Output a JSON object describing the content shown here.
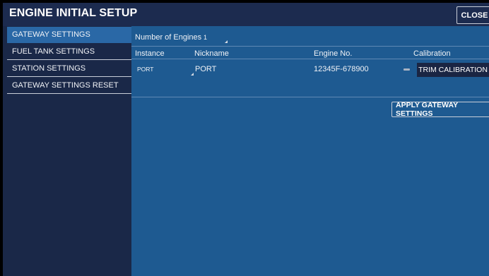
{
  "header": {
    "title": "ENGINE INITIAL SETUP",
    "close_label": "CLOSE"
  },
  "sidebar": {
    "items": [
      {
        "label": "GATEWAY SETTINGS",
        "active": true
      },
      {
        "label": "FUEL TANK SETTINGS"
      },
      {
        "label": "STATION SETTINGS"
      },
      {
        "label": "GATEWAY SETTINGS RESET"
      }
    ]
  },
  "main": {
    "engines_label": "Number of Engines",
    "engines_value": "1",
    "columns": [
      "Instance",
      "Nickname",
      "Engine No.",
      "Calibration"
    ],
    "row": {
      "instance": "PORT",
      "nickname": "PORT",
      "engine_no": "12345F-678900",
      "calibration_button": "TRIM CALIBRATION",
      "calibration_icon": "minus-icon"
    },
    "apply_label": "APPLY GATEWAY SETTINGS"
  },
  "colors": {
    "header_bg": "#1c2b4f",
    "sidebar_bg": "#1a2848",
    "sidebar_active": "#2a68a6",
    "main_bg": "#1e5a91",
    "button_dark": "#1a2543"
  }
}
